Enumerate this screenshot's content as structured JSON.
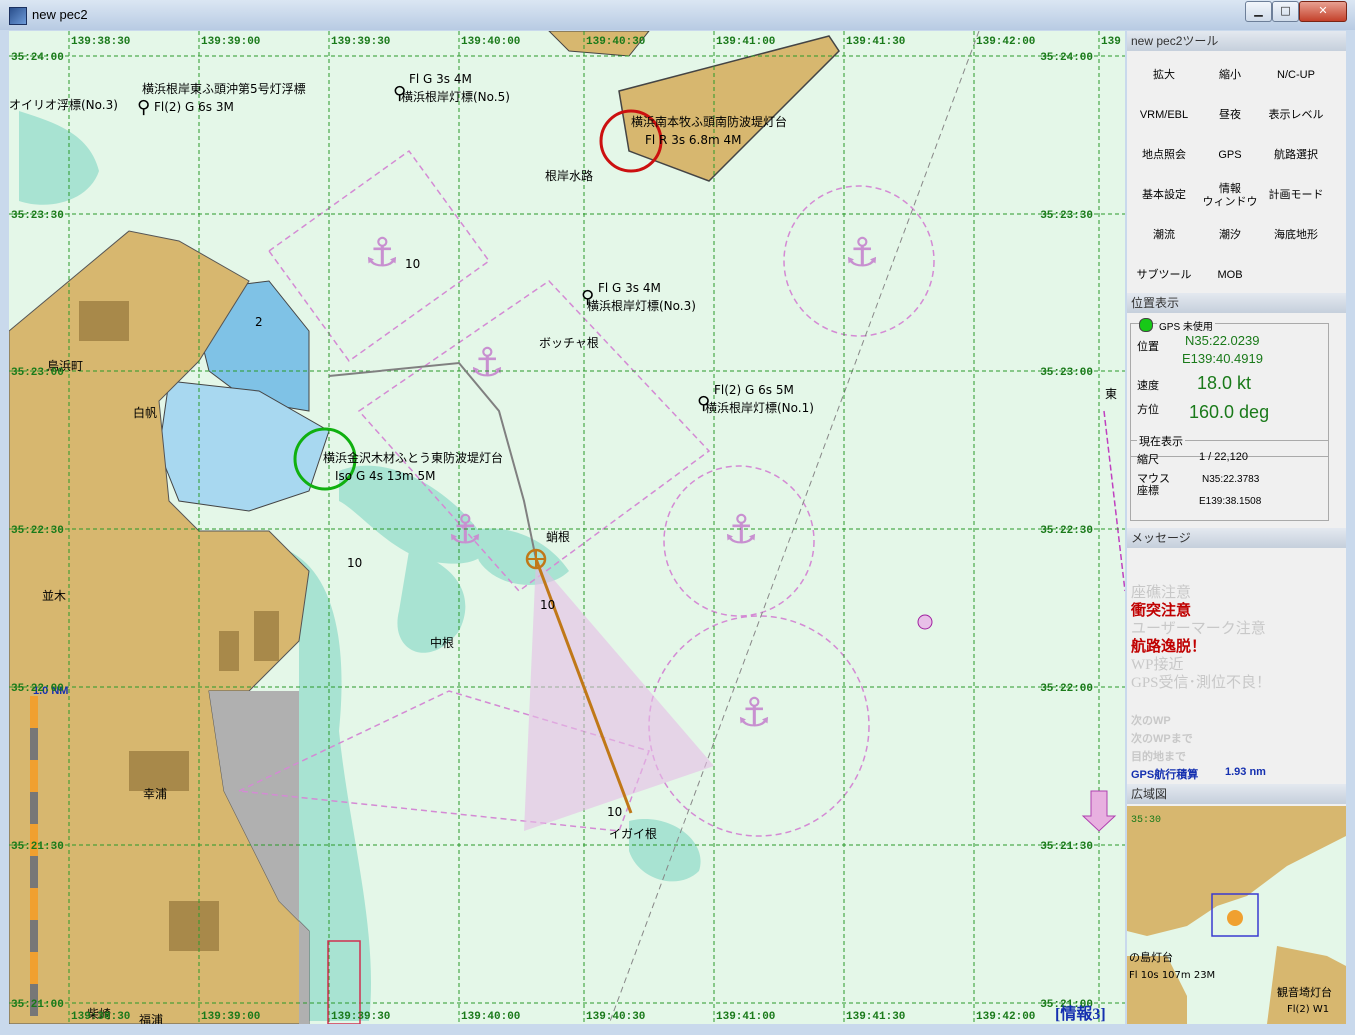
{
  "window": {
    "title": "new pec2",
    "minimize": "▁",
    "maximize": "□",
    "close": "✕"
  },
  "grid": {
    "lon_labels": [
      "139:38:30",
      "139:39:00",
      "139:39:30",
      "139:40:00",
      "139:40:30",
      "139:41:00",
      "139:41:30",
      "139:42:00",
      "139"
    ],
    "lat_labels": [
      "35:24:00",
      "35:23:30",
      "35:23:00",
      "35:22:30",
      "35:22:00",
      "35:21:30",
      "35:21:00"
    ],
    "lat_labels_left": [
      "35:24:00",
      "35:23:30",
      "35:23:00",
      "35:22:30",
      "35:22:00",
      "35:21:30",
      "35:21:00"
    ],
    "bottom_lon_labels": [
      "139:38:30",
      "139:39:00",
      "139:39:30",
      "139:40:00",
      "139:40:30",
      "139:41:00",
      "139:41:30",
      "139:42:00"
    ]
  },
  "map_labels": {
    "buoy_title1": "横浜根岸東ふ頭沖第5号灯浮標",
    "oirio": "オイリオ浮標(No.3)",
    "fl2": "Fl(2) G 6s 3M",
    "flg3s_top": "Fl G 3s 4M",
    "negishi5": "横浜根岸灯標(No.5)",
    "minami_bouhatei": "横浜南本牧ふ頭南防波堤灯台",
    "flr": "Fl R 3s 6.8m 4M",
    "negishi_suiro": "根岸水路",
    "flg3s_mid": "Fl G 3s 4M",
    "negishi3": "横浜根岸灯標(No.3)",
    "botchane": "ボッチャ根",
    "fl2_6s5m": "Fl(2) G 6s 5M",
    "negishi1": "横浜根岸灯標(No.1)",
    "torihama": "鳥浜町",
    "shiraho": "白帆",
    "kanazawa": "横浜金沢木材ふとう東防波堤灯台",
    "isog": "Iso G 4s 13m 5M",
    "tako": "蛸根",
    "namiki": "並木",
    "nakane": "中根",
    "koura": "幸浦",
    "igaine": "イガイ根",
    "fukuura": "福浦",
    "shibasaki": "柴崎",
    "higashi": "東",
    "scale": "1.0 NM",
    "info": "[情報3]",
    "depth10": "10",
    "depth2": "2"
  },
  "tools": {
    "header": "new pec2ツール",
    "buttons": [
      "拡大",
      "縮小",
      "N/C-UP",
      "VRM/EBL",
      "昼夜",
      "表示レベル",
      "地点照会",
      "GPS",
      "航路選択",
      "基本設定",
      "情報\nウィンドウ",
      "計画モード",
      "潮流",
      "潮汐",
      "海底地形",
      "サブツール",
      "MOB"
    ]
  },
  "position": {
    "header": "位置表示",
    "gps_status": "GPS 未使用",
    "pos_label": "位置",
    "lat": "N35:22.0239",
    "lon": "E139:40.4919",
    "speed_label": "速度",
    "speed": "18.0 kt",
    "heading_label": "方位",
    "heading": "160.0 deg",
    "gps_color": "#17c917"
  },
  "current": {
    "header": "現在表示",
    "scale_label": "縮尺",
    "scale": "1 / 22,120",
    "mouse_label": "マウス\n座標",
    "mouse_lat": "N35:22.3783",
    "mouse_lon": "E139:38.1508"
  },
  "messages": {
    "header": "メッセージ",
    "items": [
      {
        "text": "座礁注意",
        "active": false
      },
      {
        "text": "衝突注意",
        "active": true
      },
      {
        "text": "ユーザーマーク注意",
        "active": false
      },
      {
        "text": "航路逸脱！",
        "active": true
      },
      {
        "text": "WP接近",
        "active": false
      },
      {
        "text": "GPS受信･測位不良！",
        "active": false
      }
    ],
    "next_wp": "次のWP",
    "to_next_wp": "次のWPまで",
    "to_dest": "目的地まで",
    "gps_total_label": "GPS航行積算",
    "gps_total": "1.93 nm"
  },
  "overview": {
    "header": "広域図",
    "lat_label": "35:30",
    "label1": "の島灯台",
    "label2": "Fl 10s 107m 23M",
    "label3": "観音埼灯台",
    "label4": "Fl(2) W1"
  }
}
